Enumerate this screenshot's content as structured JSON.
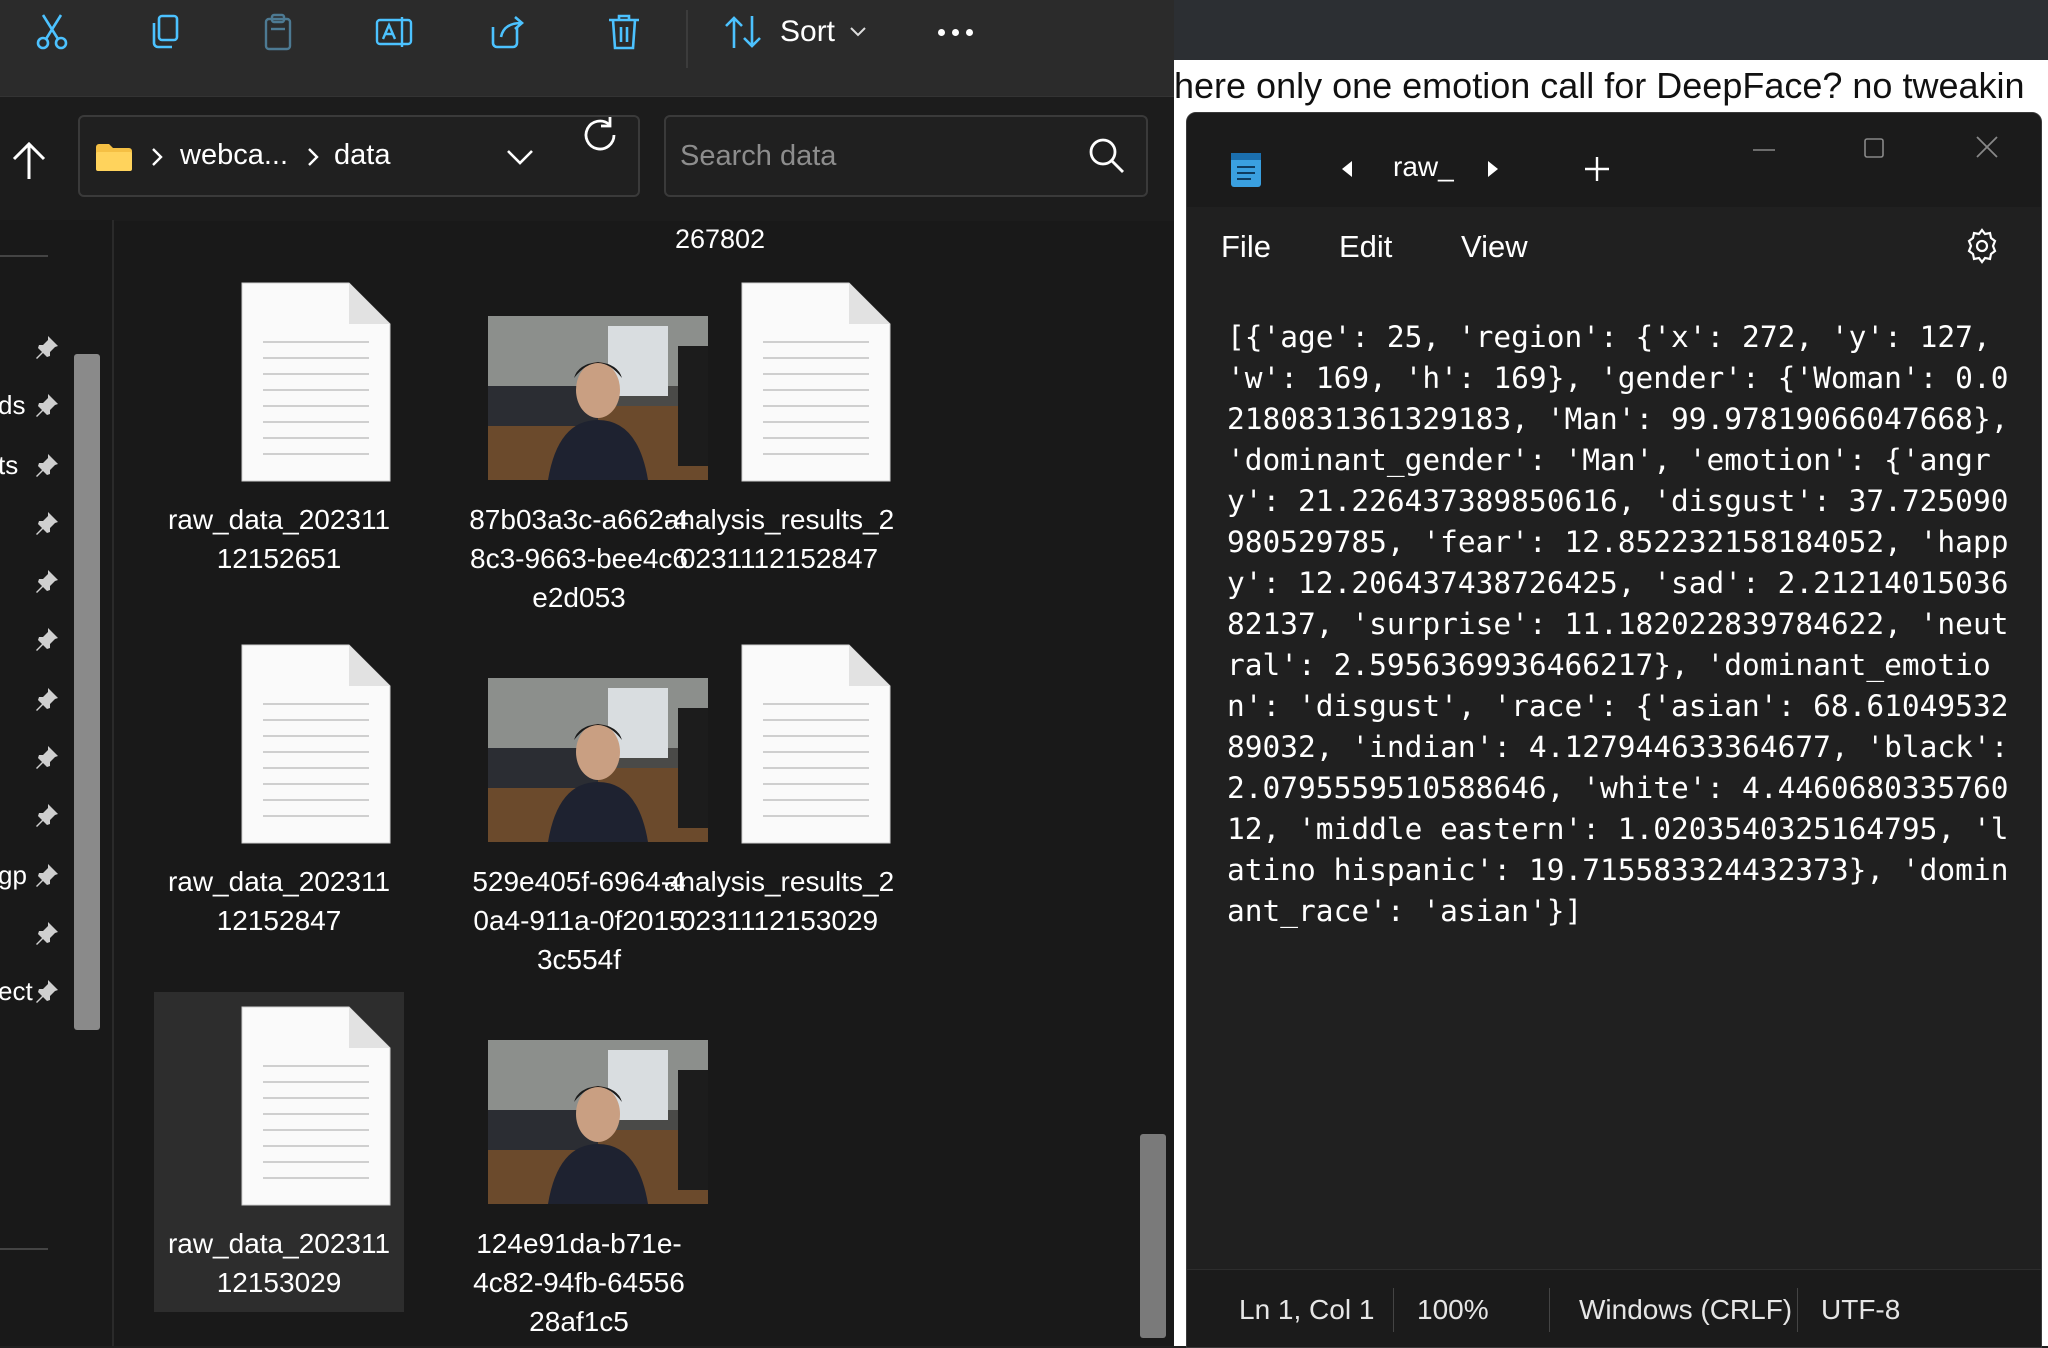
{
  "explorer": {
    "toolbar": {
      "icons": [
        "cut-icon",
        "copy-icon",
        "paste-icon",
        "rename-icon",
        "share-icon",
        "delete-icon"
      ],
      "sort_label": "Sort"
    },
    "address": {
      "crumbs": [
        "webca...",
        "data"
      ]
    },
    "search": {
      "placeholder": "Search data"
    },
    "nav_items": [
      {
        "label": "",
        "pinned": true
      },
      {
        "label": "ds",
        "pinned": true
      },
      {
        "label": "ts",
        "pinned": true
      },
      {
        "label": "",
        "pinned": true
      },
      {
        "label": "",
        "pinned": true
      },
      {
        "label": "",
        "pinned": true
      },
      {
        "label": "",
        "pinned": true
      },
      {
        "label": "",
        "pinned": true
      },
      {
        "label": "",
        "pinned": true
      },
      {
        "label": "gp",
        "pinned": true
      },
      {
        "label": "",
        "pinned": true
      },
      {
        "label": "ect",
        "pinned": true
      }
    ],
    "previous_row_tail": "267802",
    "files": [
      {
        "kind": "doc",
        "name": [
          "raw_data_202311",
          "12152651"
        ]
      },
      {
        "kind": "image",
        "name": [
          "87b03a3c-a662-4",
          "8c3-9663-bee4c6",
          "e2d053"
        ]
      },
      {
        "kind": "doc",
        "name": [
          "analysis_results_2",
          "0231112152847"
        ]
      },
      {
        "kind": "doc",
        "name": [
          "raw_data_202311",
          "12152847"
        ]
      },
      {
        "kind": "image",
        "name": [
          "529e405f-6964-4",
          "0a4-911a-0f2015",
          "3c554f"
        ]
      },
      {
        "kind": "doc",
        "name": [
          "analysis_results_2",
          "0231112153029"
        ]
      },
      {
        "kind": "doc",
        "name": [
          "raw_data_202311",
          "12153029"
        ],
        "selected": true
      },
      {
        "kind": "image",
        "name": [
          "124e91da-b71e-",
          "4c82-94fb-64556",
          "28af1c5"
        ]
      }
    ]
  },
  "background": {
    "text": "here only one emotion call for DeepFace? no tweakin"
  },
  "notepad": {
    "tab_title": "raw_",
    "menu": [
      "File",
      "Edit",
      "View"
    ],
    "content": "[{'age': 25, 'region': {'x': 272, 'y': 127, 'w': 169, 'h': 169}, 'gender': {'Woman': 0.02180831361329183, 'Man': 99.97819066047668}, 'dominant_gender': 'Man', 'emotion': {'angry': 21.226437389850616, 'disgust': 37.725090980529785, 'fear': 12.852232158184052, 'happy': 12.206437438726425, 'sad': 2.2121401503682137, 'surprise': 11.182022839784622, 'neutral': 2.5956369936466217}, 'dominant_emotion': 'disgust', 'race': {'asian': 68.6104953289032, 'indian': 4.127944633364677, 'black': 2.0795559510588646, 'white': 4.446068033576012, 'middle eastern': 1.0203540325164795, 'latino hispanic': 19.715583324432373}, 'dominant_race': 'asian'}]",
    "status": {
      "position": "Ln 1, Col 1",
      "zoom": "100%",
      "line_ending": "Windows (CRLF)",
      "encoding": "UTF-8"
    }
  }
}
